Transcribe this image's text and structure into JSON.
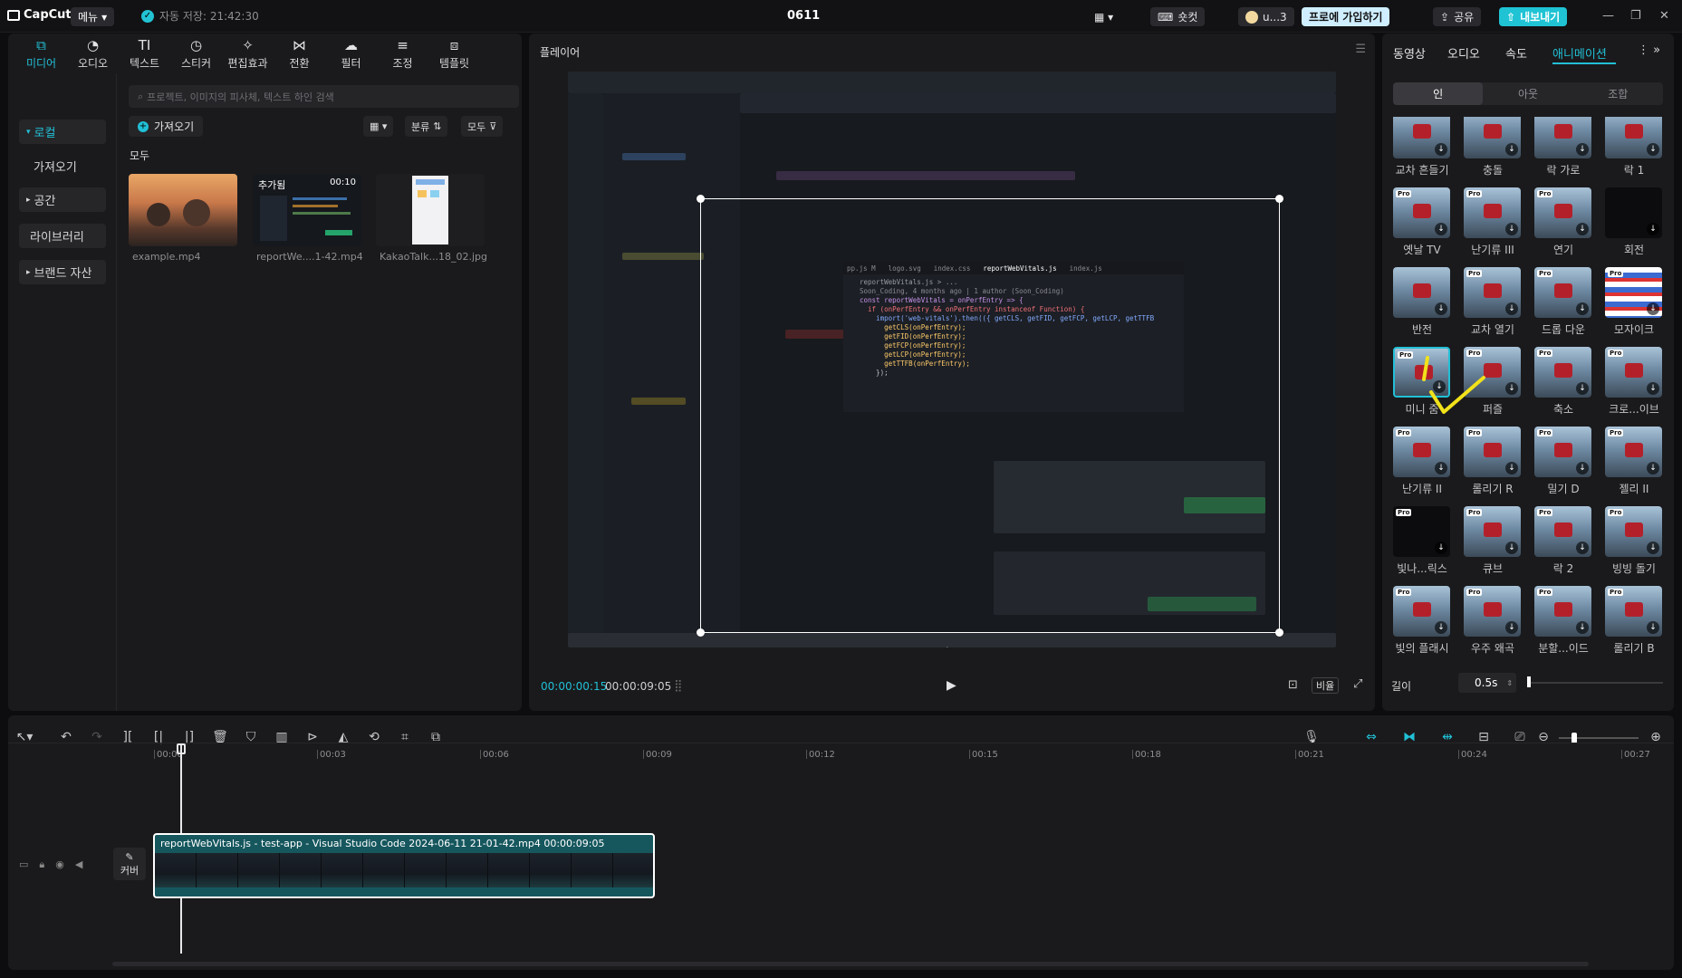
{
  "titlebar": {
    "logo": "CapCut",
    "menu": "메뉴",
    "autosave": "자동 저장: 21:42:30",
    "project": "0611",
    "shortcut": "숏컷",
    "user": "u...3",
    "join_pro": "프로에 가입하기",
    "share": "공유",
    "export": "내보내기"
  },
  "media_tabs": [
    "미디어",
    "오디오",
    "텍스트",
    "스티커",
    "편집효과",
    "전환",
    "필터",
    "조정",
    "템플릿"
  ],
  "media_tab_icons": [
    "media-icon",
    "audio-icon",
    "text-icon",
    "sticker-icon",
    "effects-icon",
    "transition-icon",
    "filter-icon",
    "adjust-icon",
    "template-icon"
  ],
  "sidebar": {
    "local": "로컬",
    "import": "가져오기",
    "space": "공간",
    "library": "라이브러리",
    "brand": "브랜드 자산"
  },
  "search": {
    "placeholder": "프로젝트, 이미지의 피사체, 텍스트 하인 검색"
  },
  "import_btn": "가져오기",
  "sort": "분류",
  "filter_all": "모두",
  "section_all": "모두",
  "media": [
    {
      "name": "example.mp4",
      "badge": ""
    },
    {
      "name": "reportWe....1-42.mp4",
      "badge": "추가됨",
      "duration": "00:10"
    },
    {
      "name": "KakaoTalk...18_02.jpg",
      "badge": ""
    }
  ],
  "player": {
    "title": "플레이어",
    "current": "00:00:00:15",
    "total": "00:00:09:05",
    "ratio": "비율",
    "code_tabs": [
      "pp.js M",
      "logo.svg",
      "index.css",
      "reportWebVitals.js",
      "index.js"
    ],
    "code_lines": [
      "reportWebVitals.js > ...",
      "Soon_Coding, 4 months ago | 1 author (Soon_Coding)",
      "const reportWebVitals = onPerfEntry => {",
      "  if (onPerfEntry && onPerfEntry instanceof Function) {",
      "    import('web-vitals').then(({ getCLS, getFID, getFCP, getLCP, getTTFB",
      "      getCLS(onPerfEntry);",
      "      getFID(onPerfEntry);",
      "      getFCP(onPerfEntry);",
      "      getLCP(onPerfEntry);",
      "      getTTFB(onPerfEntry);",
      "    });"
    ]
  },
  "right_tabs": [
    "동영상",
    "오디오",
    "속도",
    "애니메이션"
  ],
  "segments": [
    "인",
    "아웃",
    "조합"
  ],
  "effects": [
    "교차 흔들기",
    "충돌",
    "락 가로",
    "락 1",
    "옛날 TV",
    "난기류 III",
    "연기",
    "회전",
    "반전",
    "교차 열기",
    "드롭 다운",
    "모자이크",
    "미니 줌",
    "퍼즐",
    "축소",
    "크로...이브",
    "난기류 II",
    "롤리기 R",
    "밀기 D",
    "젤리 II",
    "빛나...릭스",
    "큐브",
    "락 2",
    "빙빙 돌기",
    "빛의 플래시",
    "우주 왜곡",
    "분할...이드",
    "롤리기 B"
  ],
  "duration": {
    "label": "길이",
    "value": "0.5s"
  },
  "timeline": {
    "ruler": [
      "00:00",
      "00:03",
      "00:06",
      "00:09",
      "00:12",
      "00:15",
      "00:18",
      "00:21",
      "00:24",
      "00:27"
    ],
    "clip_title": "reportWebVitals.js - test-app - Visual Studio Code 2024-06-11 21-01-42.mp4   00:00:09:05",
    "cover": "커버"
  }
}
